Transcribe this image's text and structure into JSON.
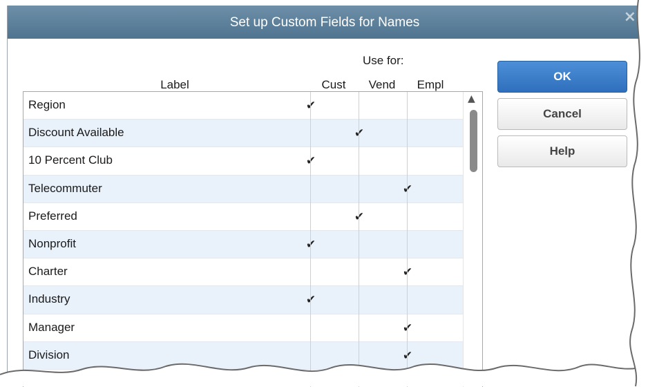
{
  "dialog": {
    "title": "Set up Custom Fields for Names"
  },
  "headers": {
    "use_for": "Use for:",
    "label": "Label",
    "cust": "Cust",
    "vend": "Vend",
    "empl": "Empl"
  },
  "check_glyph": "✔",
  "rows": [
    {
      "label": "Region",
      "cust": true,
      "vend": false,
      "empl": false
    },
    {
      "label": "Discount Available",
      "cust": false,
      "vend": true,
      "empl": false
    },
    {
      "label": "10 Percent Club",
      "cust": true,
      "vend": false,
      "empl": false
    },
    {
      "label": "Telecommuter",
      "cust": false,
      "vend": false,
      "empl": true
    },
    {
      "label": "Preferred",
      "cust": false,
      "vend": true,
      "empl": false
    },
    {
      "label": "Nonprofit",
      "cust": true,
      "vend": false,
      "empl": false
    },
    {
      "label": "Charter",
      "cust": false,
      "vend": false,
      "empl": true
    },
    {
      "label": "Industry",
      "cust": true,
      "vend": false,
      "empl": false
    },
    {
      "label": "Manager",
      "cust": false,
      "vend": false,
      "empl": true
    },
    {
      "label": "Division",
      "cust": false,
      "vend": false,
      "empl": true
    },
    {
      "label": "",
      "cust": false,
      "vend": false,
      "empl": false
    }
  ],
  "buttons": {
    "ok": "OK",
    "cancel": "Cancel",
    "help": "Help"
  },
  "icons": {
    "close": "close-icon",
    "scroll_up": "scroll-up-arrow-icon"
  },
  "colors": {
    "titlebar": "#5a7e98",
    "row_alt": "#e9f1fb",
    "ok_button": "#3a7cc8"
  }
}
